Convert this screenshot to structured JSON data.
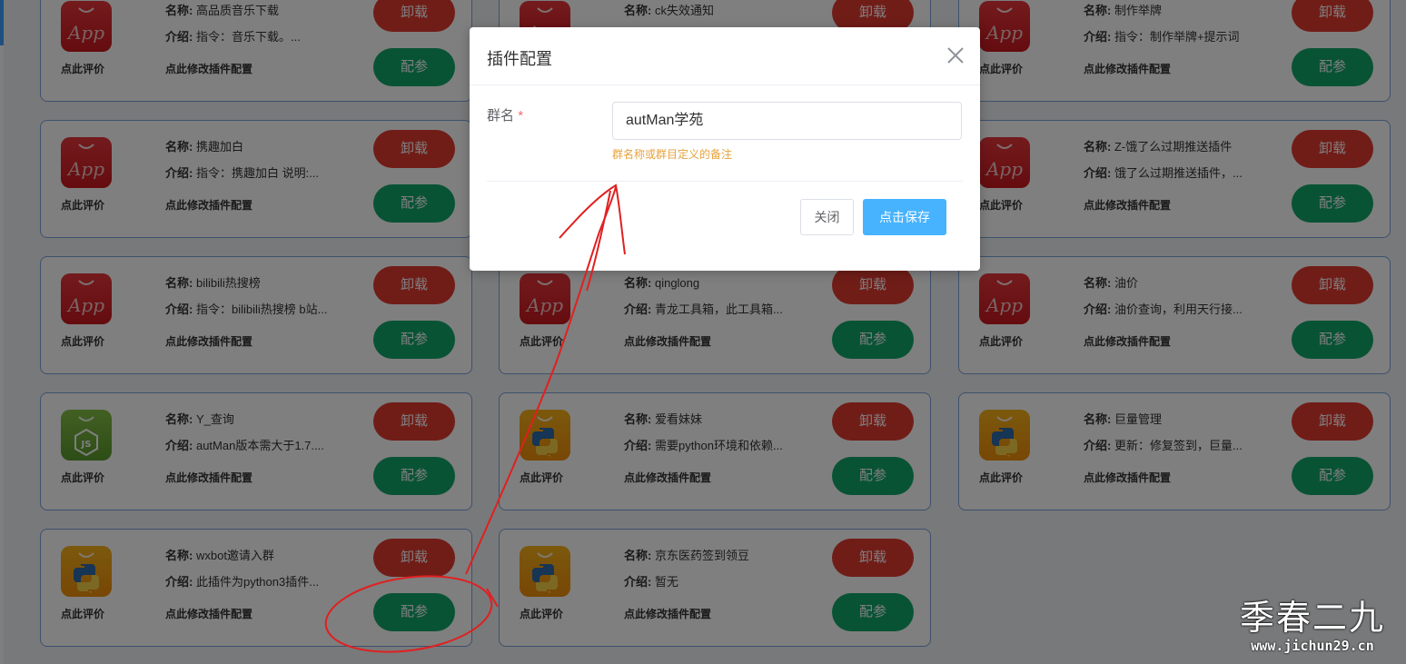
{
  "labels": {
    "name_key": "名称:",
    "desc_key": "介绍:",
    "rate": "点此评价",
    "config_link": "点此修改插件配置",
    "uninstall": "卸载",
    "configure": "配参"
  },
  "plugins": [
    {
      "name": "高品质音乐下载",
      "desc": "指令：音乐下载。...",
      "icon": "app-icon"
    },
    {
      "name": "ck失效通知",
      "desc": "",
      "icon": "app-icon"
    },
    {
      "name": "制作举牌",
      "desc": "指令：制作举牌+提示词",
      "icon": "app-icon"
    },
    {
      "name": "携趣加白",
      "desc": "指令：携趣加白 说明:...",
      "icon": "app-icon"
    },
    {
      "name": "",
      "desc": "",
      "icon": "app-icon"
    },
    {
      "name": "Z-饿了么过期推送插件",
      "desc": "饿了么过期推送插件，...",
      "icon": "app-icon"
    },
    {
      "name": "bilibili热搜榜",
      "desc": "指令：bilibili热搜榜 b站...",
      "icon": "app-icon"
    },
    {
      "name": "qinglong",
      "desc": "青龙工具箱，此工具箱...",
      "icon": "app-icon"
    },
    {
      "name": "油价",
      "desc": "油价查询，利用天行接...",
      "icon": "app-icon"
    },
    {
      "name": "Y_查询",
      "desc": "autMan版本需大于1.7....",
      "icon": "nodejs-icon"
    },
    {
      "name": "爱看妹妹",
      "desc": "需要python环境和依赖...",
      "icon": "python-icon"
    },
    {
      "name": "巨量管理",
      "desc": "更新：修复签到，巨量...",
      "icon": "python-icon"
    },
    {
      "name": "wxbot邀请入群",
      "desc": "此插件为python3插件...",
      "icon": "python-icon"
    },
    {
      "name": "京东医药签到领豆",
      "desc": "暂无",
      "icon": "python-icon"
    }
  ],
  "dialog": {
    "title": "插件配置",
    "field_label": "群名",
    "required_mark": "*",
    "field_value": "autMan学苑",
    "hint": "群名称或群目定义的备注",
    "close_button": "关闭",
    "save_button": "点击保存"
  },
  "watermark": {
    "main": "季春二九",
    "sub": "www.jichun29.cn"
  },
  "colors": {
    "uninstall": "#e03a30",
    "configure": "#13a66a",
    "save": "#47b3ff",
    "hint": "#e6a23c",
    "annotation": "#e02020"
  }
}
